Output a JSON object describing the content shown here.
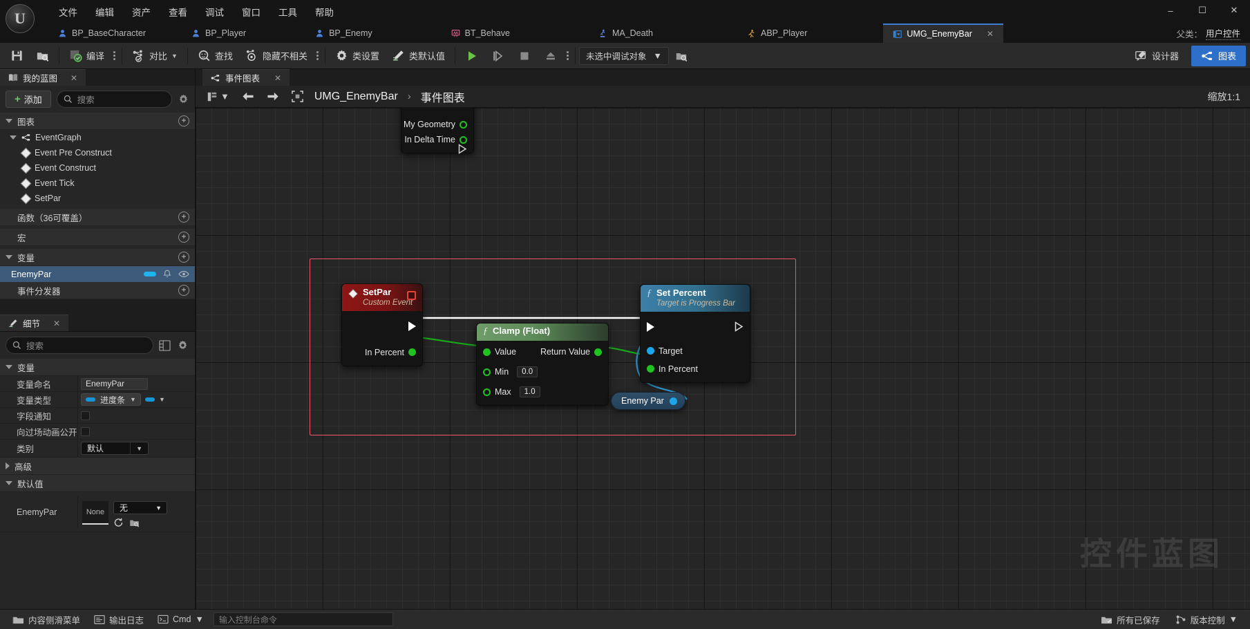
{
  "window": {
    "minimize": "–",
    "maximize": "☐",
    "close": "✕"
  },
  "menu": {
    "items": [
      {
        "label": "文件"
      },
      {
        "label": "编辑"
      },
      {
        "label": "资产"
      },
      {
        "label": "查看"
      },
      {
        "label": "调试"
      },
      {
        "label": "窗口"
      },
      {
        "label": "工具"
      },
      {
        "label": "帮助"
      }
    ]
  },
  "asset_tabs": {
    "items": [
      {
        "label": "BP_BaseCharacter",
        "icon": "blueprint-character-icon",
        "active": false
      },
      {
        "label": "BP_Player",
        "icon": "blueprint-character-icon",
        "active": false
      },
      {
        "label": "BP_Enemy",
        "icon": "blueprint-character-icon",
        "active": false
      },
      {
        "label": "BT_Behave",
        "icon": "behavior-tree-icon",
        "active": false
      },
      {
        "label": "MA_Death",
        "icon": "montage-icon",
        "active": false
      },
      {
        "label": "ABP_Player",
        "icon": "anim-blueprint-icon",
        "active": false
      },
      {
        "label": "UMG_EnemyBar",
        "icon": "widget-blueprint-icon",
        "active": true
      }
    ],
    "close_glyph": "✕",
    "parent_label": "父类：",
    "parent_value": "用户控件"
  },
  "toolbar": {
    "save_label": "",
    "compile_label": "编译",
    "diff_label": "对比",
    "find_label": "查找",
    "hide_unrelated_label": "隐藏不相关",
    "class_settings_label": "类设置",
    "class_defaults_label": "类默认值",
    "debug_object_value": "未选中调试对象",
    "designer_label": "设计器",
    "graph_label": "图表"
  },
  "myblueprint": {
    "tab_title": "我的蓝图",
    "tab_close": "✕",
    "add_label": "添加",
    "search_placeholder": "搜索",
    "sections": {
      "graphs": "图表",
      "functions": "函数（36可覆盖）",
      "macros": "宏",
      "variables": "变量",
      "event_dispatchers": "事件分发器"
    },
    "event_graph": "EventGraph",
    "events": [
      {
        "label": "Event Pre Construct"
      },
      {
        "label": "Event Construct"
      },
      {
        "label": "Event Tick"
      },
      {
        "label": "SetPar"
      }
    ],
    "variables": [
      {
        "label": "EnemyPar",
        "selected": true,
        "color": "#1eb4f0"
      }
    ]
  },
  "details": {
    "tab_title": "细节",
    "tab_close": "✕",
    "search_placeholder": "搜索",
    "section_variable": "变量",
    "section_advanced": "高级",
    "section_default": "默认值",
    "rows": [
      {
        "label": "变量命名",
        "value": "EnemyPar",
        "kind": "text"
      },
      {
        "label": "变量类型",
        "value": "进度条",
        "kind": "type"
      },
      {
        "label": "字段通知",
        "value": "",
        "kind": "check"
      },
      {
        "label": "向过场动画公开",
        "value": "",
        "kind": "check"
      },
      {
        "label": "类别",
        "value": "默认",
        "kind": "combo"
      }
    ],
    "default_row": {
      "label": "EnemyPar",
      "thumb": "None",
      "asset_value": "无"
    }
  },
  "graph": {
    "tab_title": "事件图表",
    "tab_close": "✕",
    "breadcrumb_root": "UMG_EnemyBar",
    "breadcrumb_sep": "›",
    "breadcrumb_current": "事件图表",
    "zoom_label": "缩放1:1",
    "watermark": "控件蓝图",
    "ghost_node": {
      "pins": [
        "My Geometry",
        "In Delta Time"
      ]
    },
    "nodes": [
      {
        "id": "setpar",
        "title": "SetPar",
        "subtitle": "Custom Event",
        "header_color": "red",
        "outputs": [
          "In Percent"
        ]
      },
      {
        "id": "clamp",
        "title": "Clamp (Float)",
        "subtitle": "",
        "header_color": "green",
        "inputs": [
          "Value",
          "Min",
          "Max"
        ],
        "input_values": {
          "Min": "0.0",
          "Max": "1.0"
        },
        "outputs": [
          "Return Value"
        ]
      },
      {
        "id": "setpercent",
        "title": "Set Percent",
        "subtitle": "Target is Progress Bar",
        "header_color": "blue",
        "inputs": [
          "Target",
          "In Percent"
        ]
      }
    ],
    "var_node": {
      "title": "Enemy Par"
    }
  },
  "statusbar": {
    "content_drawer": "内容侧滑菜单",
    "output_log": "输出日志",
    "cmd_label": "Cmd",
    "cmd_placeholder": "输入控制台命令",
    "all_saved": "所有已保存",
    "source_control": "版本控制"
  },
  "colors": {
    "accent_blue": "#2d6fc9",
    "selection_red": "#f0566e",
    "exec_white": "#ffffff",
    "float_green": "#1fc21f",
    "object_blue": "#1aa6e8"
  }
}
